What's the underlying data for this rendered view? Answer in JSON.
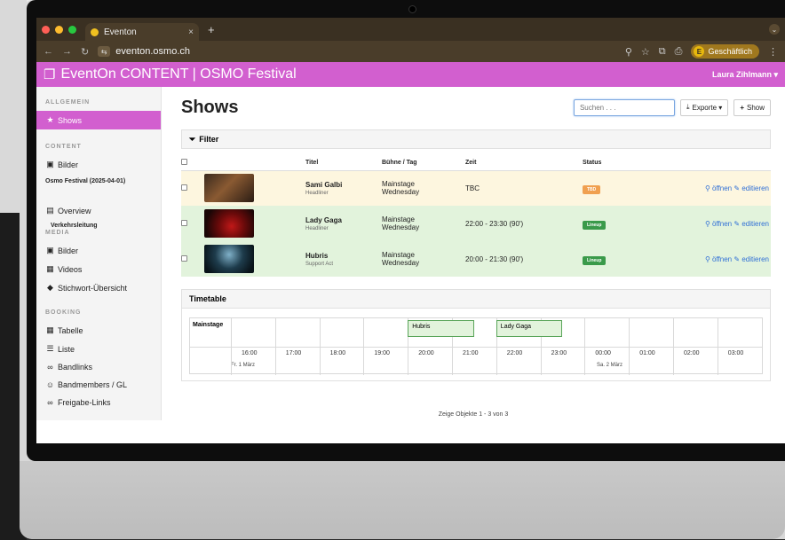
{
  "browser": {
    "tab_title": "Eventon",
    "tab_close": "×",
    "new_tab": "+",
    "tab_menu": "⌄",
    "url": "eventon.osmo.ch",
    "profile_label": "Geschäftlich",
    "profile_initial": "E"
  },
  "app": {
    "title": "EventOn CONTENT | OSMO Festival",
    "user": "Laura Zihlmann ▾"
  },
  "sidebar": {
    "section_allgemein": "ALLGEMEIN",
    "shows": "Shows",
    "section_content": "CONTENT",
    "bilder_content": "Bilder",
    "event": "Osmo Festival (2025-04-01)",
    "overview": "Overview",
    "verkehrsleitung": "Verkehrsleitung",
    "section_media": "MEDIA",
    "bilder_media": "Bilder",
    "videos": "Videos",
    "stichwort": "Stichwort-Übersicht",
    "section_booking": "BOOKING",
    "tabelle": "Tabelle",
    "liste": "Liste",
    "bandlinks": "Bandlinks",
    "bandmembers": "Bandmembers / GL",
    "freigabe": "Freigabe-Links"
  },
  "main": {
    "title": "Shows",
    "search_placeholder": "Suchen . . .",
    "exporte": "Exporte ▾",
    "add_show": "Show",
    "filter": "Filter"
  },
  "table": {
    "headers": {
      "titel": "Titel",
      "buehne": "Bühne / Tag",
      "zeit": "Zeit",
      "status": "Status"
    },
    "rows": [
      {
        "name": "Sami Galbi",
        "role": "Headliner",
        "stage": "Mainstage",
        "day": "Wednesday",
        "time": "TBC",
        "status": "TBD",
        "status_color": "#f0a050",
        "open": "öffnen",
        "edit": "editieren"
      },
      {
        "name": "Lady Gaga",
        "role": "Headliner",
        "stage": "Mainstage",
        "day": "Wednesday",
        "time": "22:00 - 23:30 (90')",
        "status": "Lineup",
        "status_color": "#3a9a4a",
        "open": "öffnen",
        "edit": "editieren"
      },
      {
        "name": "Hubris",
        "role": "Support Act",
        "stage": "Mainstage",
        "day": "Wednesday",
        "time": "20:00 - 21:30 (90')",
        "status": "Lineup",
        "status_color": "#3a9a4a",
        "open": "öffnen",
        "edit": "editieren"
      }
    ]
  },
  "timetable": {
    "title": "Timetable",
    "stage": "Mainstage",
    "hours": [
      "16:00",
      "17:00",
      "18:00",
      "19:00",
      "20:00",
      "21:00",
      "22:00",
      "23:00",
      "00:00",
      "01:00",
      "02:00",
      "03:00"
    ],
    "date_1": "Fr. 1 März",
    "date_2": "Sa. 2 März",
    "blocks": [
      {
        "label": "Hubris",
        "start_hour": "20:00"
      },
      {
        "label": "Lady Gaga",
        "start_hour": "22:00"
      }
    ]
  },
  "footer": {
    "pagination": "Zeige Objekte 1 - 3 von 3"
  },
  "colors": {
    "brand": "#d25fcf",
    "row_tbd": "#fdf6df",
    "row_lineup": "#e2f3dc",
    "link": "#2f6fd6"
  }
}
